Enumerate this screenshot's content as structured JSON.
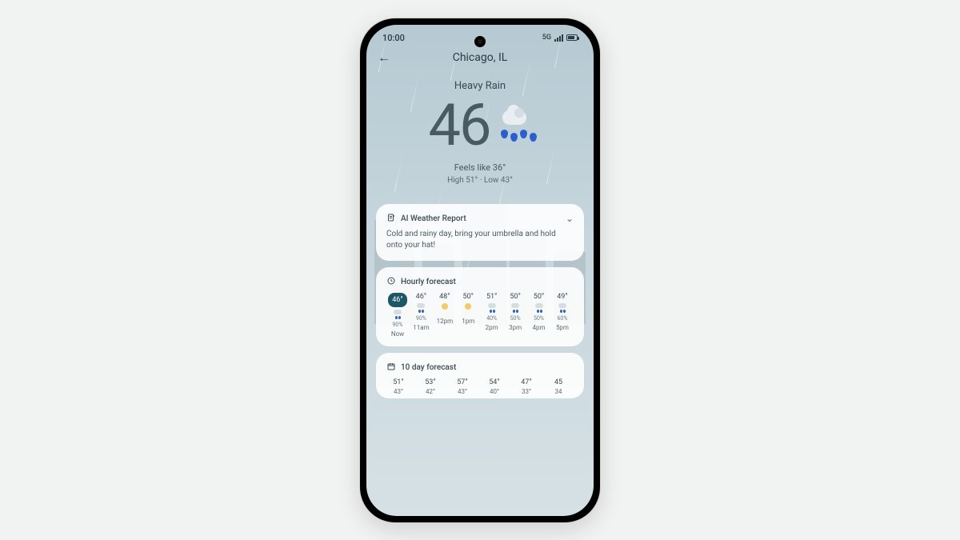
{
  "status": {
    "time": "10:00",
    "network": "5G"
  },
  "header": {
    "location": "Chicago, IL"
  },
  "current": {
    "condition": "Heavy Rain",
    "temp": "46",
    "feels_like": "Feels like 36°",
    "hilo": "High 51°  ·  Low 43°"
  },
  "ai_report": {
    "title": "AI Weather Report",
    "text": "Cold and rainy day, bring your umbrella and hold onto your hat!"
  },
  "hourly": {
    "title": "Hourly forecast",
    "items": [
      {
        "temp": "46°",
        "pct": "90%",
        "label": "Now",
        "kind": "rain",
        "now": true
      },
      {
        "temp": "46°",
        "pct": "90%",
        "label": "11am",
        "kind": "rain"
      },
      {
        "temp": "48°",
        "pct": "",
        "label": "12pm",
        "kind": "sunny"
      },
      {
        "temp": "50°",
        "pct": "",
        "label": "1pm",
        "kind": "sunny"
      },
      {
        "temp": "51°",
        "pct": "40%",
        "label": "2pm",
        "kind": "rain"
      },
      {
        "temp": "50°",
        "pct": "50%",
        "label": "3pm",
        "kind": "rain"
      },
      {
        "temp": "50°",
        "pct": "50%",
        "label": "4pm",
        "kind": "rain"
      },
      {
        "temp": "49°",
        "pct": "60%",
        "label": "5pm",
        "kind": "rain"
      }
    ]
  },
  "daily": {
    "title": "10 day forecast",
    "items": [
      {
        "hi": "51°",
        "lo": "43°"
      },
      {
        "hi": "53°",
        "lo": "42°"
      },
      {
        "hi": "57°",
        "lo": "43°"
      },
      {
        "hi": "54°",
        "lo": "40°"
      },
      {
        "hi": "47°",
        "lo": "33°"
      },
      {
        "hi": "45",
        "lo": "34"
      }
    ]
  }
}
